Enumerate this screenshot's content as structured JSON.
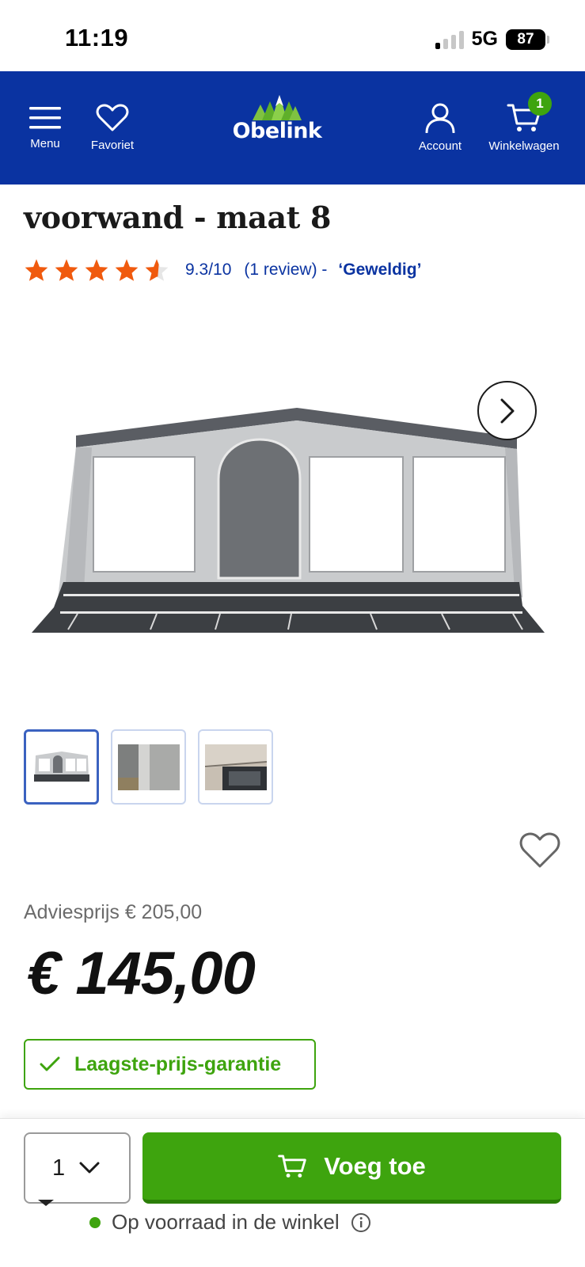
{
  "status_bar": {
    "time": "11:19",
    "network": "5G",
    "battery": "87"
  },
  "header": {
    "menu_label": "Menu",
    "favorites_label": "Favoriet",
    "logo_text": "Obelink",
    "account_label": "Account",
    "cart_label": "Winkelwagen",
    "cart_count": "1",
    "background_color": "#0a33a1"
  },
  "product": {
    "title_line": "voorwand - maat 8",
    "rating": {
      "stars": 4.5,
      "score": "9.3/10",
      "reviews": "(1 review) -",
      "quality": "‘Geweldig’"
    },
    "thumbnail_count": 3,
    "advice_price": "Adviesprijs € 205,00",
    "price": "€ 145,00",
    "guarantee": "Laagste-prijs-garantie"
  },
  "cart_bar": {
    "quantity": "1",
    "add_button": "Voeg toe",
    "stock_status": "Op voorraad in de winkel",
    "accent_color": "#3ea40e"
  }
}
